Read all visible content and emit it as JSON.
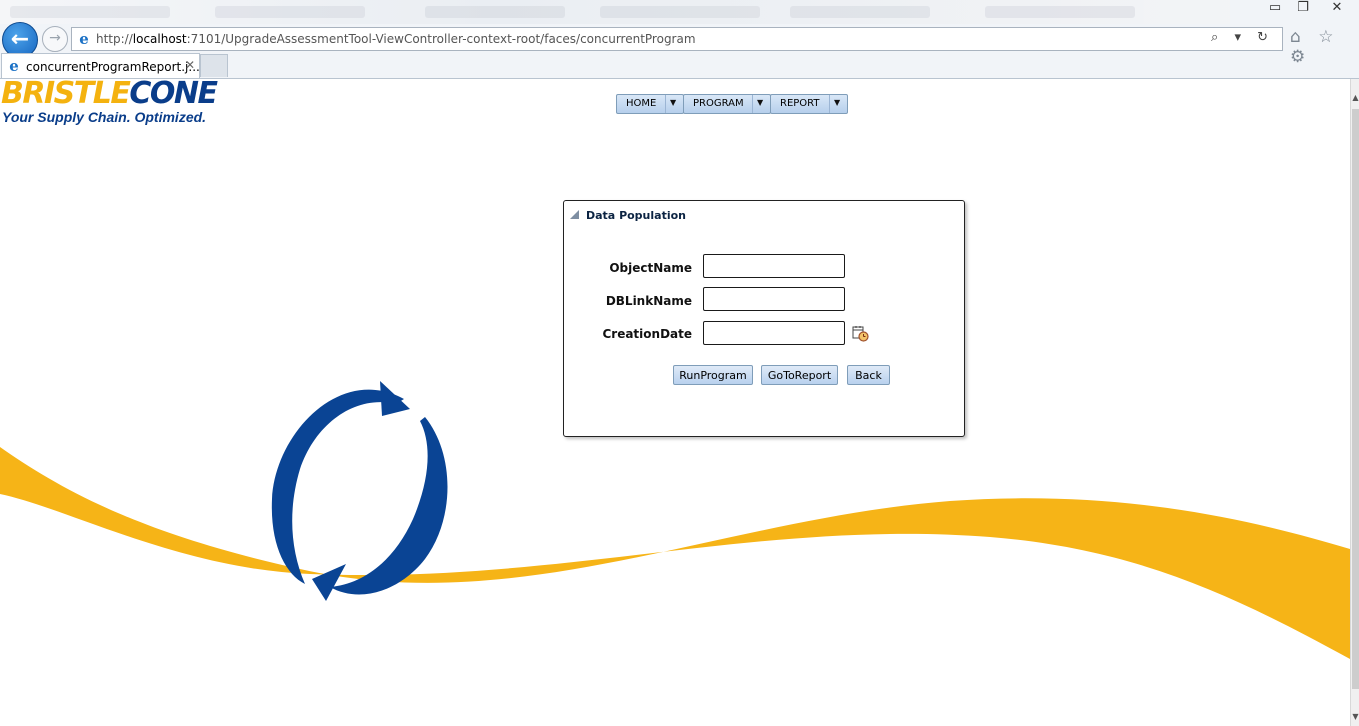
{
  "browser": {
    "url_prefix": "http://",
    "url_host": "localhost",
    "url_rest": ":7101/UpgradeAssessmentTool-ViewController-context-root/faces/concurrentProgram",
    "active_tab_title": "concurrentProgramReport.j...",
    "tab_close_glyph": "✕",
    "back_glyph": "←",
    "forward_glyph": "→",
    "address_tools": "⌕ ▾ ↻",
    "right_icons": "⌂ ☆ ⚙",
    "window_controls": {
      "minimize": "▭",
      "restore": "❐",
      "close": "✕"
    },
    "ie_glyph": "e"
  },
  "logo": {
    "brand_part1": "BRISTLE",
    "brand_part2": "CONE",
    "tagline": "Your Supply Chain. Optimized."
  },
  "menu": {
    "items": [
      {
        "label": "HOME"
      },
      {
        "label": "PROGRAM"
      },
      {
        "label": "REPORT"
      }
    ],
    "arrow_glyph": "▼"
  },
  "panel": {
    "title": "Data Population",
    "fields": [
      {
        "label": "ObjectName",
        "value": ""
      },
      {
        "label": "DBLinkName",
        "value": ""
      },
      {
        "label": "CreationDate",
        "value": ""
      }
    ],
    "buttons": {
      "run": "RunProgram",
      "goto_report": "GoToReport",
      "back": "Back"
    }
  },
  "colors": {
    "brand_yellow": "#f4b20f",
    "brand_blue": "#0a3d8a",
    "button_fill": "#c9dbf2",
    "swoosh_yellow": "#f6b417"
  }
}
